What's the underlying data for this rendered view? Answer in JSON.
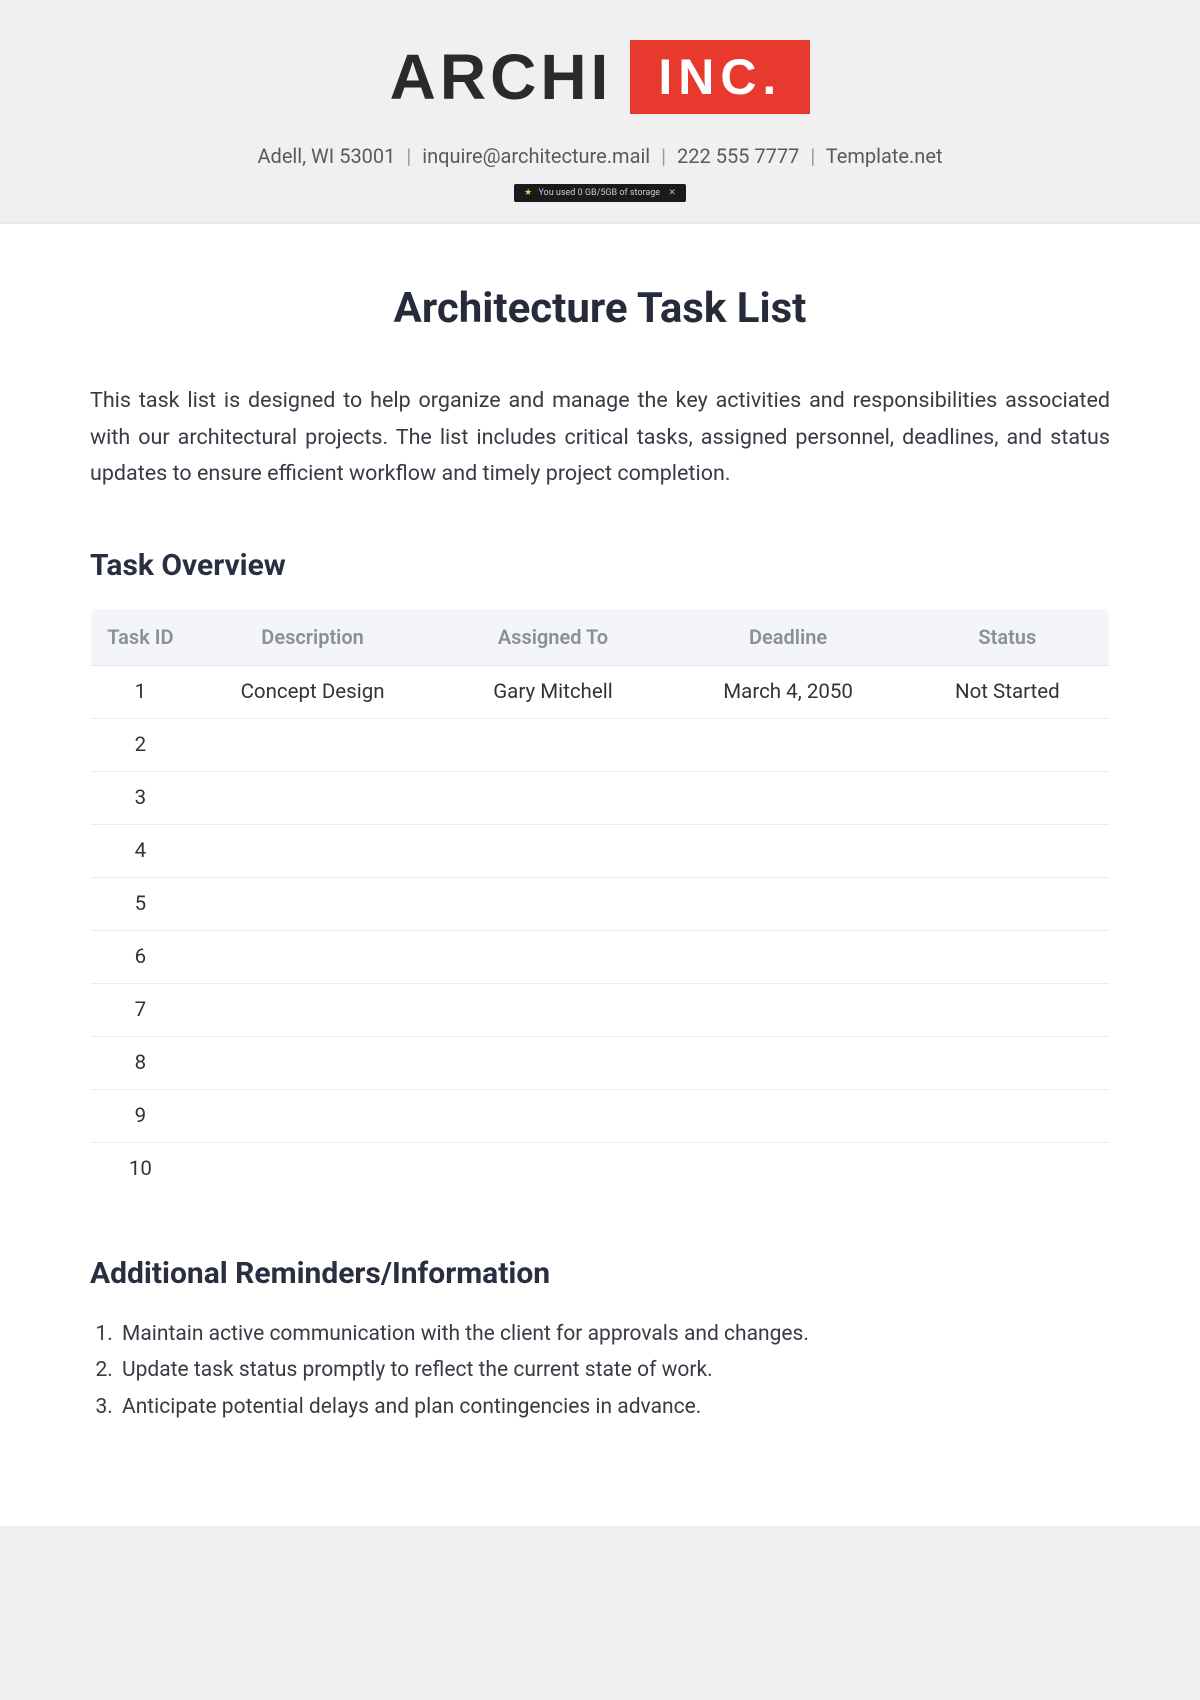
{
  "header": {
    "logo_main": "ARCHI",
    "logo_box": "INC.",
    "address": "Adell, WI 53001",
    "email": "inquire@architecture.mail",
    "phone": "222 555 7777",
    "source": "Template.net",
    "storage_notice": "You used 0 GB/5GB of storage"
  },
  "document": {
    "title": "Architecture Task List",
    "intro": "This task list is designed to help organize and manage the key activities and responsibilities associated with our architectural projects. The list includes critical tasks, assigned personnel, deadlines, and status updates to ensure efficient workflow and timely project completion."
  },
  "task_section": {
    "heading": "Task Overview",
    "columns": {
      "id": "Task ID",
      "description": "Description",
      "assigned": "Assigned To",
      "deadline": "Deadline",
      "status": "Status"
    },
    "rows": [
      {
        "id": "1",
        "description": "Concept Design",
        "assigned": "Gary Mitchell",
        "deadline": "March 4, 2050",
        "status": "Not Started"
      },
      {
        "id": "2",
        "description": "",
        "assigned": "",
        "deadline": "",
        "status": ""
      },
      {
        "id": "3",
        "description": "",
        "assigned": "",
        "deadline": "",
        "status": ""
      },
      {
        "id": "4",
        "description": "",
        "assigned": "",
        "deadline": "",
        "status": ""
      },
      {
        "id": "5",
        "description": "",
        "assigned": "",
        "deadline": "",
        "status": ""
      },
      {
        "id": "6",
        "description": "",
        "assigned": "",
        "deadline": "",
        "status": ""
      },
      {
        "id": "7",
        "description": "",
        "assigned": "",
        "deadline": "",
        "status": ""
      },
      {
        "id": "8",
        "description": "",
        "assigned": "",
        "deadline": "",
        "status": ""
      },
      {
        "id": "9",
        "description": "",
        "assigned": "",
        "deadline": "",
        "status": ""
      },
      {
        "id": "10",
        "description": "",
        "assigned": "",
        "deadline": "",
        "status": ""
      }
    ]
  },
  "reminders": {
    "heading": "Additional Reminders/Information",
    "items": [
      "Maintain active communication with the client for approvals and changes.",
      "Update task status promptly to reflect the current state of work.",
      "Anticipate potential delays and plan contingencies in advance."
    ]
  }
}
